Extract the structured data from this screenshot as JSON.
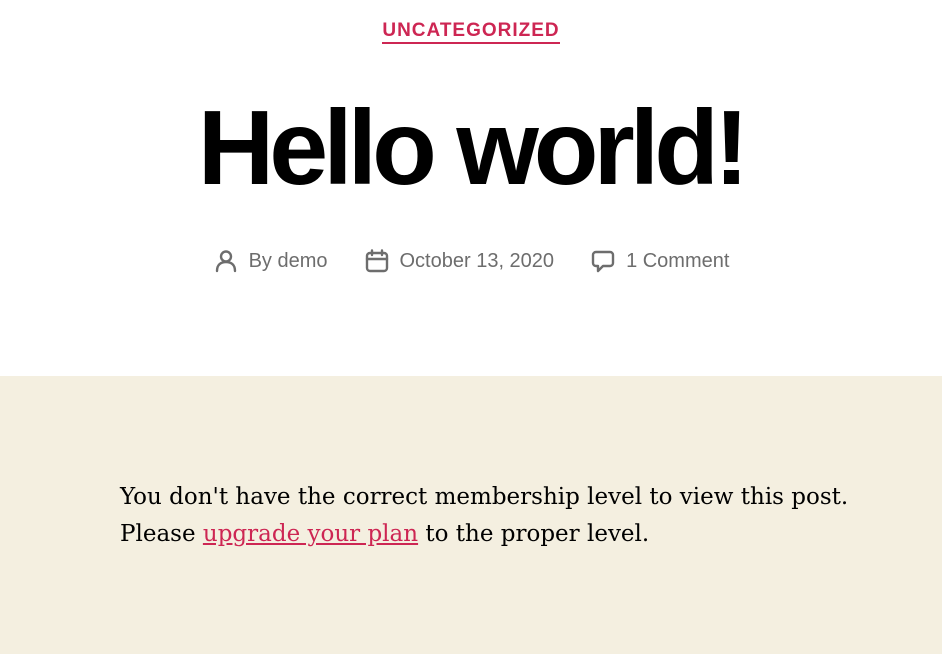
{
  "post": {
    "category": "UNCATEGORIZED",
    "title": "Hello world!",
    "meta": {
      "author_prefix": "By",
      "author": "demo",
      "date": "October 13, 2020",
      "comments": "1 Comment"
    }
  },
  "content": {
    "notice_text": "You don't have the correct membership level to view this post. Please",
    "upgrade_link": "upgrade your plan",
    "notice_suffix": "to the proper level."
  },
  "colors": {
    "accent": "#cd2653",
    "content_background": "#f4efe0",
    "meta_text": "#6d6d6d"
  },
  "icons": {
    "author": "person-icon",
    "date": "calendar-icon",
    "comments": "speech-bubble-icon"
  }
}
